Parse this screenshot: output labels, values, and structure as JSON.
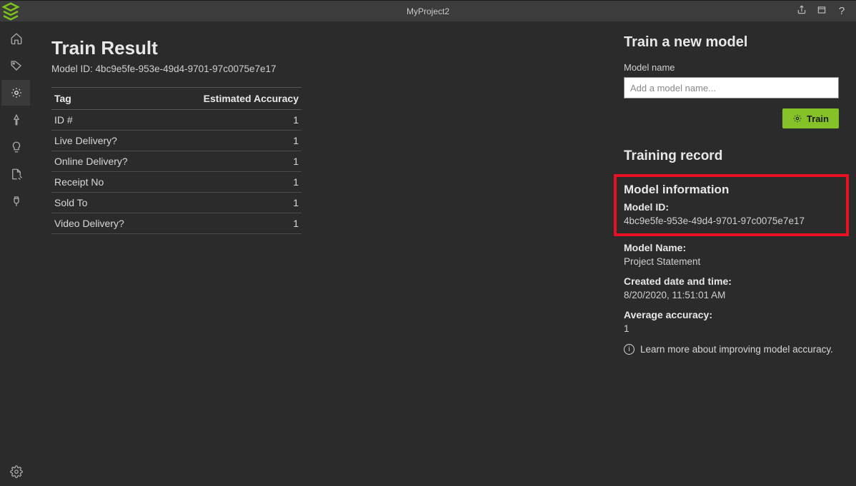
{
  "titlebar": {
    "title": "MyProject2"
  },
  "main": {
    "heading": "Train Result",
    "model_id_label": "Model ID:",
    "model_id_value": "4bc9e5fe-953e-49d4-9701-97c0075e7e17",
    "table": {
      "col_tag": "Tag",
      "col_acc": "Estimated Accuracy",
      "rows": [
        {
          "tag": "ID #",
          "acc": "1"
        },
        {
          "tag": "Live Delivery?",
          "acc": "1"
        },
        {
          "tag": "Online Delivery?",
          "acc": "1"
        },
        {
          "tag": "Receipt No",
          "acc": "1"
        },
        {
          "tag": "Sold To",
          "acc": "1"
        },
        {
          "tag": "Video Delivery?",
          "acc": "1"
        }
      ]
    }
  },
  "right": {
    "heading": "Train a new model",
    "model_name_label": "Model name",
    "model_name_placeholder": "Add a model name...",
    "train_button": "Train",
    "record_heading": "Training record",
    "info_heading": "Model information",
    "model_id_label": "Model ID:",
    "model_id_value": "4bc9e5fe-953e-49d4-9701-97c0075e7e17",
    "model_name_k": "Model Name:",
    "model_name_v": "Project Statement",
    "created_k": "Created date and time:",
    "created_v": "8/20/2020, 11:51:01 AM",
    "avgacc_k": "Average accuracy:",
    "avgacc_v": "1",
    "learn_more": "Learn more about improving model accuracy."
  }
}
